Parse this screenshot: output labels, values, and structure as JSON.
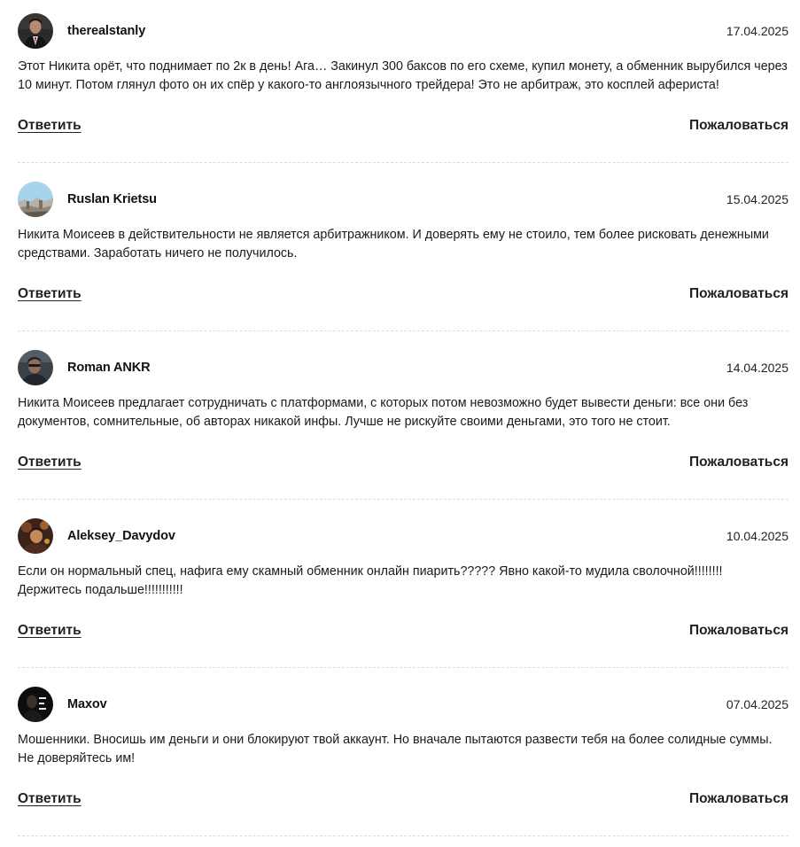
{
  "labels": {
    "reply": "Ответить",
    "report": "Пожаловаться"
  },
  "comments": [
    {
      "username": "therealstanly",
      "date": "17.04.2025",
      "text": "Этот Никита орёт, что поднимает по 2к в день! Ага… Закинул 300 баксов по его схеме, купил монету, а обменник вырубился через 10 минут. Потом глянул фото он их спёр у какого-то англоязычного трейдера! Это не арбитраж, это косплей афериста!"
    },
    {
      "username": "Ruslan Krietsu",
      "date": "15.04.2025",
      "text": "Никита Моисеев в действительности не является арбитражником. И доверять ему не стоило, тем более рисковать денежными средствами. Заработать ничего не получилось."
    },
    {
      "username": "Roman ANKR",
      "date": "14.04.2025",
      "text": "Никита Моисеев предлагает сотрудничать с платформами, с которых потом невозможно будет вывести деньги: все они без документов, сомнительные, об авторах никакой инфы. Лучше не рискуйте своими деньгами, это того не стоит."
    },
    {
      "username": "Aleksey_Davydov",
      "date": "10.04.2025",
      "text": "Если он нормальный спец, нафига ему скамный обменник онлайн пиарить????? Явно какой-то мудила сволочной!!!!!!!! Держитесь подальше!!!!!!!!!!!"
    },
    {
      "username": "Maxov",
      "date": "07.04.2025",
      "text": "Мошенники. Вносишь им деньги и они блокируют твой аккаунт. Но вначале пытаются развести тебя на более солидные суммы. Не доверяйтесь им!"
    }
  ]
}
